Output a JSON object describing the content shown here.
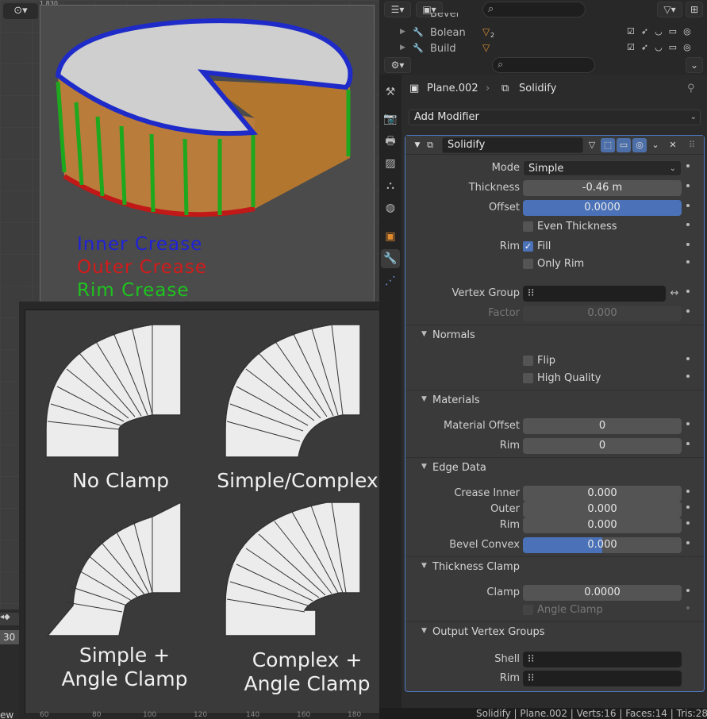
{
  "viewport": {
    "header_icon": "⊙▾",
    "stat_text": "1,830",
    "legend": {
      "inner": "Inner Crease",
      "outer": "Outer Crease",
      "rim": "Rim Crease",
      "inner_color": "#1f22d8",
      "outer_color": "#d41a1a",
      "rim_color": "#1ec41e"
    },
    "clamp_labels": {
      "no_clamp": "No Clamp",
      "simple_complex": "Simple/Complex",
      "simple_angle": [
        "Simple +",
        "Angle Clamp"
      ],
      "complex_angle": [
        "Complex +",
        "Angle Clamp"
      ]
    },
    "timeline_frame": "30",
    "ruler_ticks": [
      "60",
      "80",
      "100",
      "120",
      "140",
      "160",
      "180"
    ],
    "footer_text": "ew"
  },
  "outliner": {
    "rows": [
      {
        "name": "Bevel"
      },
      {
        "name": "Bolean",
        "badge": "2"
      },
      {
        "name": "Build"
      }
    ]
  },
  "properties": {
    "breadcrumb": {
      "object": "Plane.002",
      "modifier": "Solidify"
    },
    "add_modifier": "Add Modifier",
    "modifier": {
      "name": "Solidify",
      "mode_label": "Mode",
      "mode_value": "Simple",
      "thickness_label": "Thickness",
      "thickness_value": "-0.46 m",
      "offset_label": "Offset",
      "offset_value": "0.0000",
      "even_thickness": "Even Thickness",
      "rim_label": "Rim",
      "fill": "Fill",
      "only_rim": "Only Rim",
      "vertex_group_label": "Vertex Group",
      "factor_label": "Factor",
      "factor_value": "0.000",
      "normals": {
        "title": "Normals",
        "flip": "Flip",
        "high_quality": "High Quality"
      },
      "materials": {
        "title": "Materials",
        "offset_label": "Material Offset",
        "offset_value": "0",
        "rim_label": "Rim",
        "rim_value": "0"
      },
      "edge_data": {
        "title": "Edge Data",
        "crease_inner_label": "Crease Inner",
        "crease_inner_value": "0.000",
        "outer_label": "Outer",
        "outer_value": "0.000",
        "rim_label": "Rim",
        "rim_value": "0.000",
        "bevel_convex_label": "Bevel Convex",
        "bevel_convex_value": "0.000"
      },
      "thickness_clamp": {
        "title": "Thickness Clamp",
        "clamp_label": "Clamp",
        "clamp_value": "0.0000",
        "angle_clamp": "Angle Clamp"
      },
      "output_vertex_groups": {
        "title": "Output Vertex Groups",
        "shell_label": "Shell",
        "rim_label": "Rim"
      }
    }
  },
  "statusbar": "Solidify | Plane.002 | Verts:16 | Faces:14 | Tris:28 |",
  "colors": {
    "accent": "#4b72b8",
    "panel_border": "#4e7bc4"
  }
}
